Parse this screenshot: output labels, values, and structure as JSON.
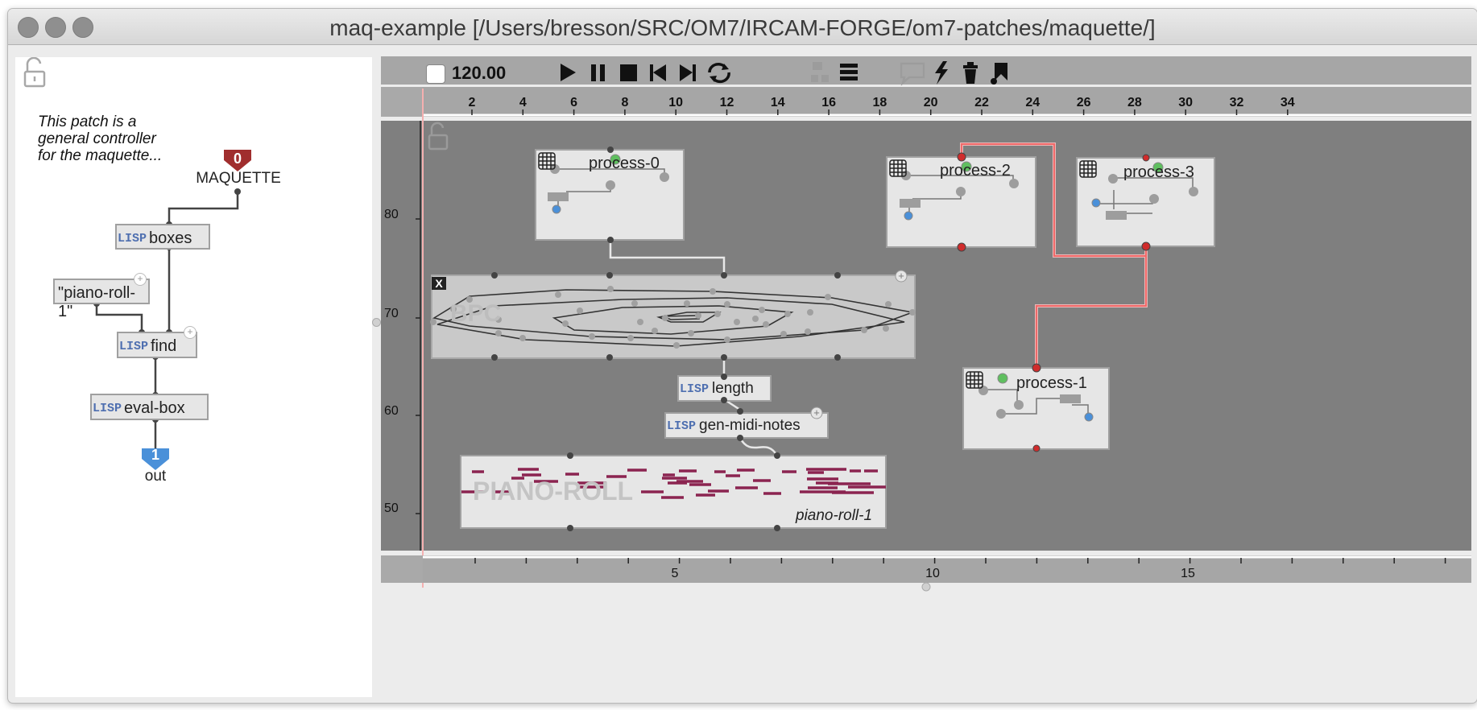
{
  "window": {
    "title": "maq-example  [/Users/bresson/SRC/OM7/IRCAM-FORGE/om7-patches/maquette/]"
  },
  "colors": {
    "canvas_bg": "#7f7f7f",
    "ruler_bg": "#a6a6a6",
    "box_bg": "#e6e6e6",
    "connection_red": "#f06a6a",
    "note_color": "#8b2450",
    "lisp_label": "#4e6fb0",
    "inlet_green": "#5fbf5f",
    "inlet_blue": "#4a90d9"
  },
  "patch": {
    "lock_icon": "lock-open-icon",
    "comment_lines": [
      "This patch is a",
      "general controller",
      "for the maquette..."
    ],
    "input": {
      "index": "0",
      "label": "MAQUETTE"
    },
    "boxes_label": "boxes",
    "string_box": "\"piano-roll-1\"",
    "find_label": "find",
    "evalbox_label": "eval-box",
    "output": {
      "index": "1",
      "label": "out"
    },
    "lisp_tag": "LISP"
  },
  "toolbar": {
    "tempo": "120.00",
    "icons": [
      "play-icon",
      "pause-icon",
      "stop-icon",
      "prev-icon",
      "next-icon",
      "loop-icon",
      "tracks-icon",
      "list-icon",
      "comment-icon",
      "lightning-icon",
      "trash-icon",
      "palette-icon"
    ]
  },
  "ruler_top": {
    "labels": [
      "2",
      "4",
      "6",
      "8",
      "10",
      "12",
      "14",
      "16",
      "18",
      "20",
      "22",
      "24",
      "26",
      "28",
      "30",
      "32",
      "34"
    ]
  },
  "ruler_bottom": {
    "labels": [
      "5",
      "10",
      "15"
    ]
  },
  "ruler_left": {
    "labels": [
      "80",
      "70",
      "60",
      "50"
    ]
  },
  "maquette": {
    "processes": [
      {
        "name": "process-0"
      },
      {
        "name": "process-2"
      },
      {
        "name": "process-3"
      },
      {
        "name": "process-1"
      }
    ],
    "bpc": {
      "watermark": "BPC",
      "close": "X"
    },
    "length_label": "length",
    "genmidi_label": "gen-midi-notes",
    "pianoroll": {
      "watermark": "PIANO-ROLL",
      "name": "piano-roll-1"
    }
  }
}
